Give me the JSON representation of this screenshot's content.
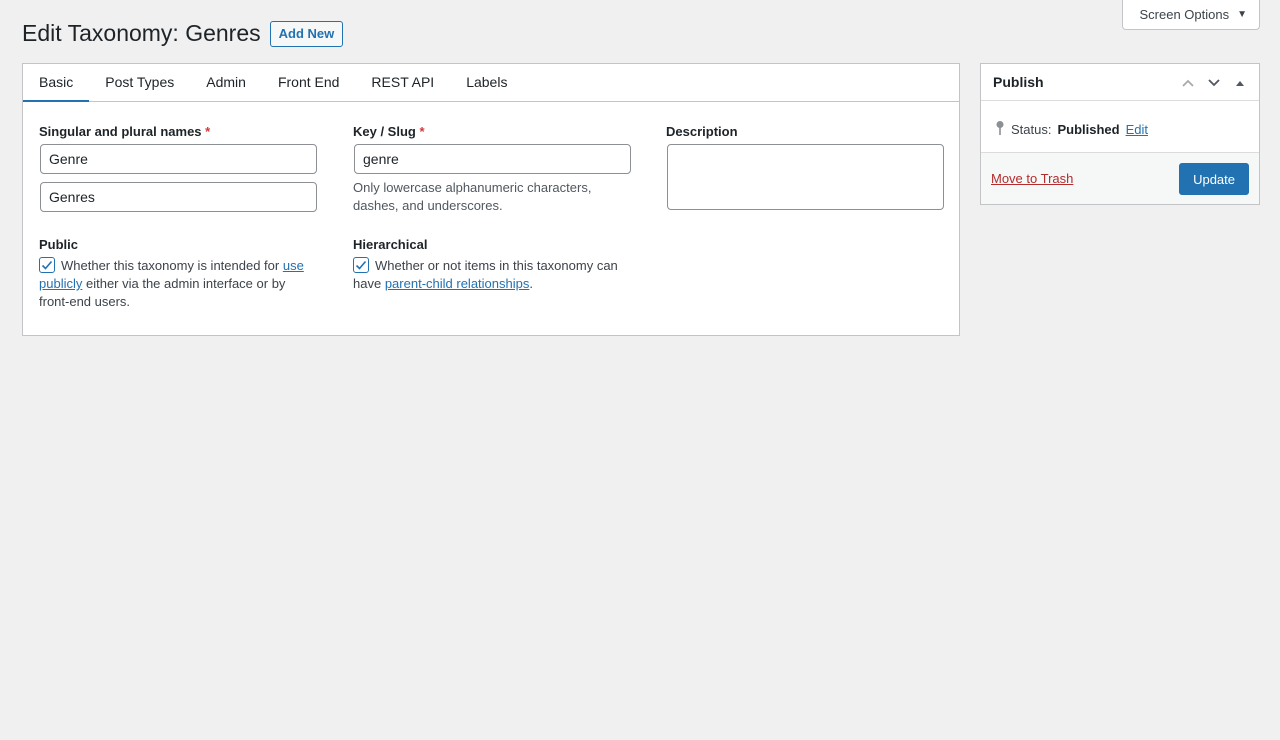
{
  "screen_options": {
    "label": "Screen Options"
  },
  "page": {
    "title": "Edit Taxonomy: Genres",
    "add_new": "Add New"
  },
  "tabs": [
    {
      "label": "Basic",
      "active": true
    },
    {
      "label": "Post Types"
    },
    {
      "label": "Admin"
    },
    {
      "label": "Front End"
    },
    {
      "label": "REST API"
    },
    {
      "label": "Labels"
    }
  ],
  "fields": {
    "names": {
      "label": "Singular and plural names",
      "required": "*",
      "singular": "Genre",
      "plural": "Genres"
    },
    "slug": {
      "label": "Key / Slug",
      "required": "*",
      "value": "genre",
      "help": "Only lowercase alphanumeric characters, dashes, and underscores."
    },
    "description": {
      "label": "Description",
      "value": ""
    },
    "public": {
      "label": "Public",
      "checked": true,
      "text_before": "Whether this taxonomy is intended for",
      "link": "use publicly",
      "text_after": "either via the admin interface or by front-end users."
    },
    "hierarchical": {
      "label": "Hierarchical",
      "checked": true,
      "text_before": "Whether or not items in this taxonomy can have",
      "link": "parent-child relationships",
      "text_after": "."
    }
  },
  "publish": {
    "title": "Publish",
    "status_label": "Status:",
    "status_value": "Published",
    "edit_link": "Edit",
    "trash_link": "Move to Trash",
    "update_button": "Update"
  },
  "colors": {
    "accent": "#2271b1",
    "danger": "#b32d2e",
    "required": "#d63638"
  }
}
